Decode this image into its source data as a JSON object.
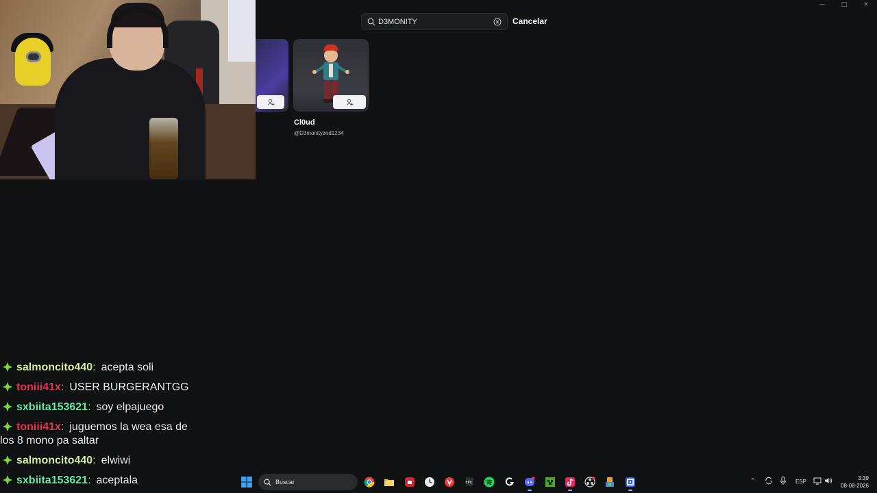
{
  "search": {
    "value": "D3MONITY",
    "cancel_label": "Cancelar"
  },
  "results": [
    {
      "name": "Cl0ud",
      "handle": "@D3monityzed1234"
    }
  ],
  "chat": [
    {
      "user": "salmoncito440",
      "color": "#d8f39a",
      "text": "acepta soli"
    },
    {
      "user": "toniii41x",
      "color": "#e8345a",
      "text": "USER BURGERANTGG"
    },
    {
      "user": "sxbiita153621",
      "color": "#5ef0a8",
      "text": "soy elpajuego"
    },
    {
      "user": "toniii41x",
      "color": "#e8345a",
      "text": "juguemos la wea esa de",
      "cont": "los 8 mono pa saltar"
    },
    {
      "user": "salmoncito440",
      "color": "#d8f39a",
      "text": "elwiwi"
    },
    {
      "user": "sxbiita153621",
      "color": "#5ef0a8",
      "text": "aceptala"
    }
  ],
  "taskbar": {
    "search_label": "Buscar",
    "language": "ESP",
    "time": "3:39",
    "date": "08-08-2026"
  },
  "colors": {
    "background": "#111214",
    "accent_gem": "#7dd63a"
  }
}
